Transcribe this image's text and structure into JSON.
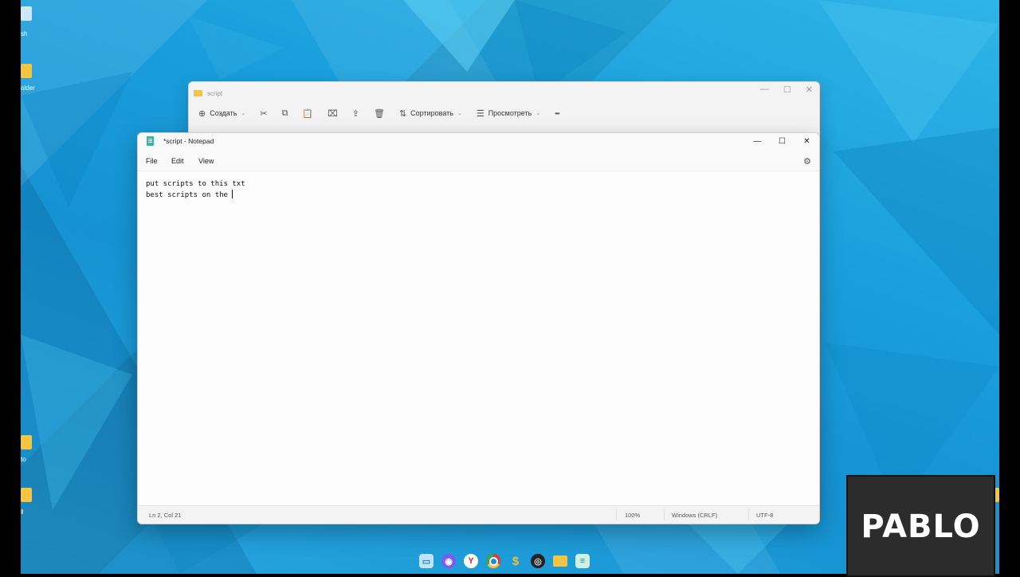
{
  "desktop": {
    "labels": [
      "sh",
      "older",
      "to",
      "ll"
    ]
  },
  "explorer": {
    "title": "script",
    "controls": {
      "minimize": "—",
      "maximize": "☐",
      "close": "✕"
    },
    "toolbar": {
      "create_label": "Создать",
      "sort_label": "Сортировать",
      "view_label": "Просмотреть",
      "more_label": "•••"
    }
  },
  "notepad": {
    "title": "*script - Notepad",
    "controls": {
      "minimize": "—",
      "maximize": "☐",
      "close": "✕"
    },
    "menu": {
      "file": "File",
      "edit": "Edit",
      "view": "View"
    },
    "content": {
      "lines": [
        "put scripts to this txt",
        "best scripts on the "
      ]
    },
    "status": {
      "position": "Ln 2, Col 21",
      "zoom": "100%",
      "line_ending": "Windows (CRLF)",
      "encoding": "UTF-8"
    }
  },
  "taskbar": {
    "apps": [
      "task-view",
      "video-call",
      "yandex-browser",
      "chrome",
      "dollar-app",
      "obs",
      "file-explorer",
      "notepad"
    ]
  },
  "watermark": {
    "text": "PABLO"
  }
}
